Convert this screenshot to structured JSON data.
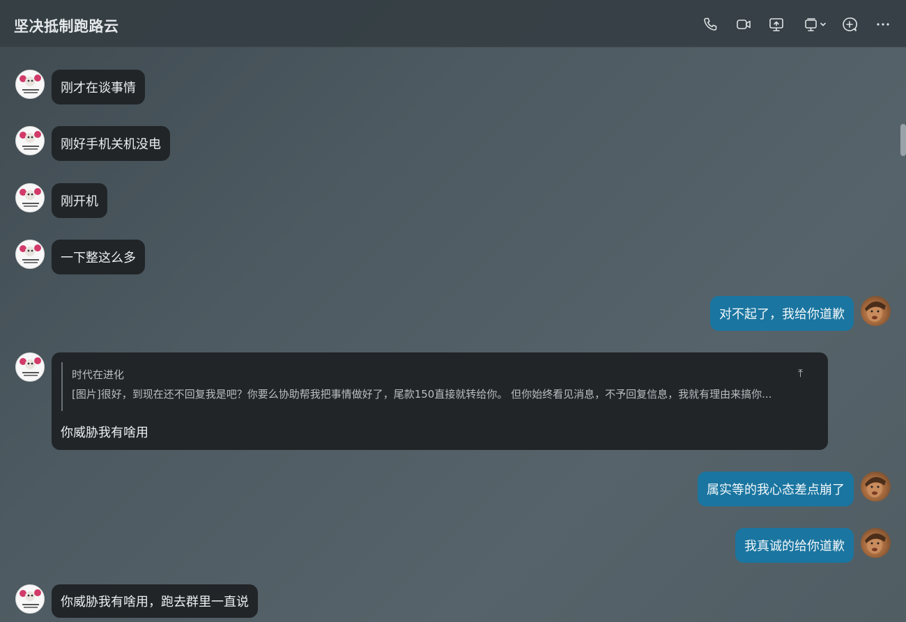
{
  "header": {
    "title": "坚决抵制跑路云",
    "icons": [
      "phone-icon",
      "video-call-icon",
      "screen-share-icon",
      "remote-desktop-icon",
      "add-icon",
      "more-icon"
    ]
  },
  "messages": [
    {
      "side": "left",
      "text": "刚才在谈事情"
    },
    {
      "side": "left",
      "text": "刚好手机关机没电"
    },
    {
      "side": "left",
      "text": "刚开机"
    },
    {
      "side": "left",
      "text": "一下整这么多"
    },
    {
      "side": "right",
      "text": "对不起了，我给你道歉"
    },
    {
      "side": "left",
      "quote": {
        "author": "时代在进化",
        "text": "[图片]很好，到现在还不回复我是吧？你要么协助帮我把事情做好了，尾款150直接就转给你。 但你始终看见消息，不予回复信息，我就有理由来搞你...",
        "jump": "⤒"
      },
      "text": "你威胁我有啥用"
    },
    {
      "side": "right",
      "text": "属实等的我心态差点崩了"
    },
    {
      "side": "right",
      "text": "我真诚的给你道歉"
    },
    {
      "side": "left",
      "text": "你威胁我有啥用，跑去群里一直说"
    }
  ],
  "colors": {
    "left_bubble": "#212528",
    "right_bubble": "#1a75a0",
    "header_bg": "#343e43"
  }
}
